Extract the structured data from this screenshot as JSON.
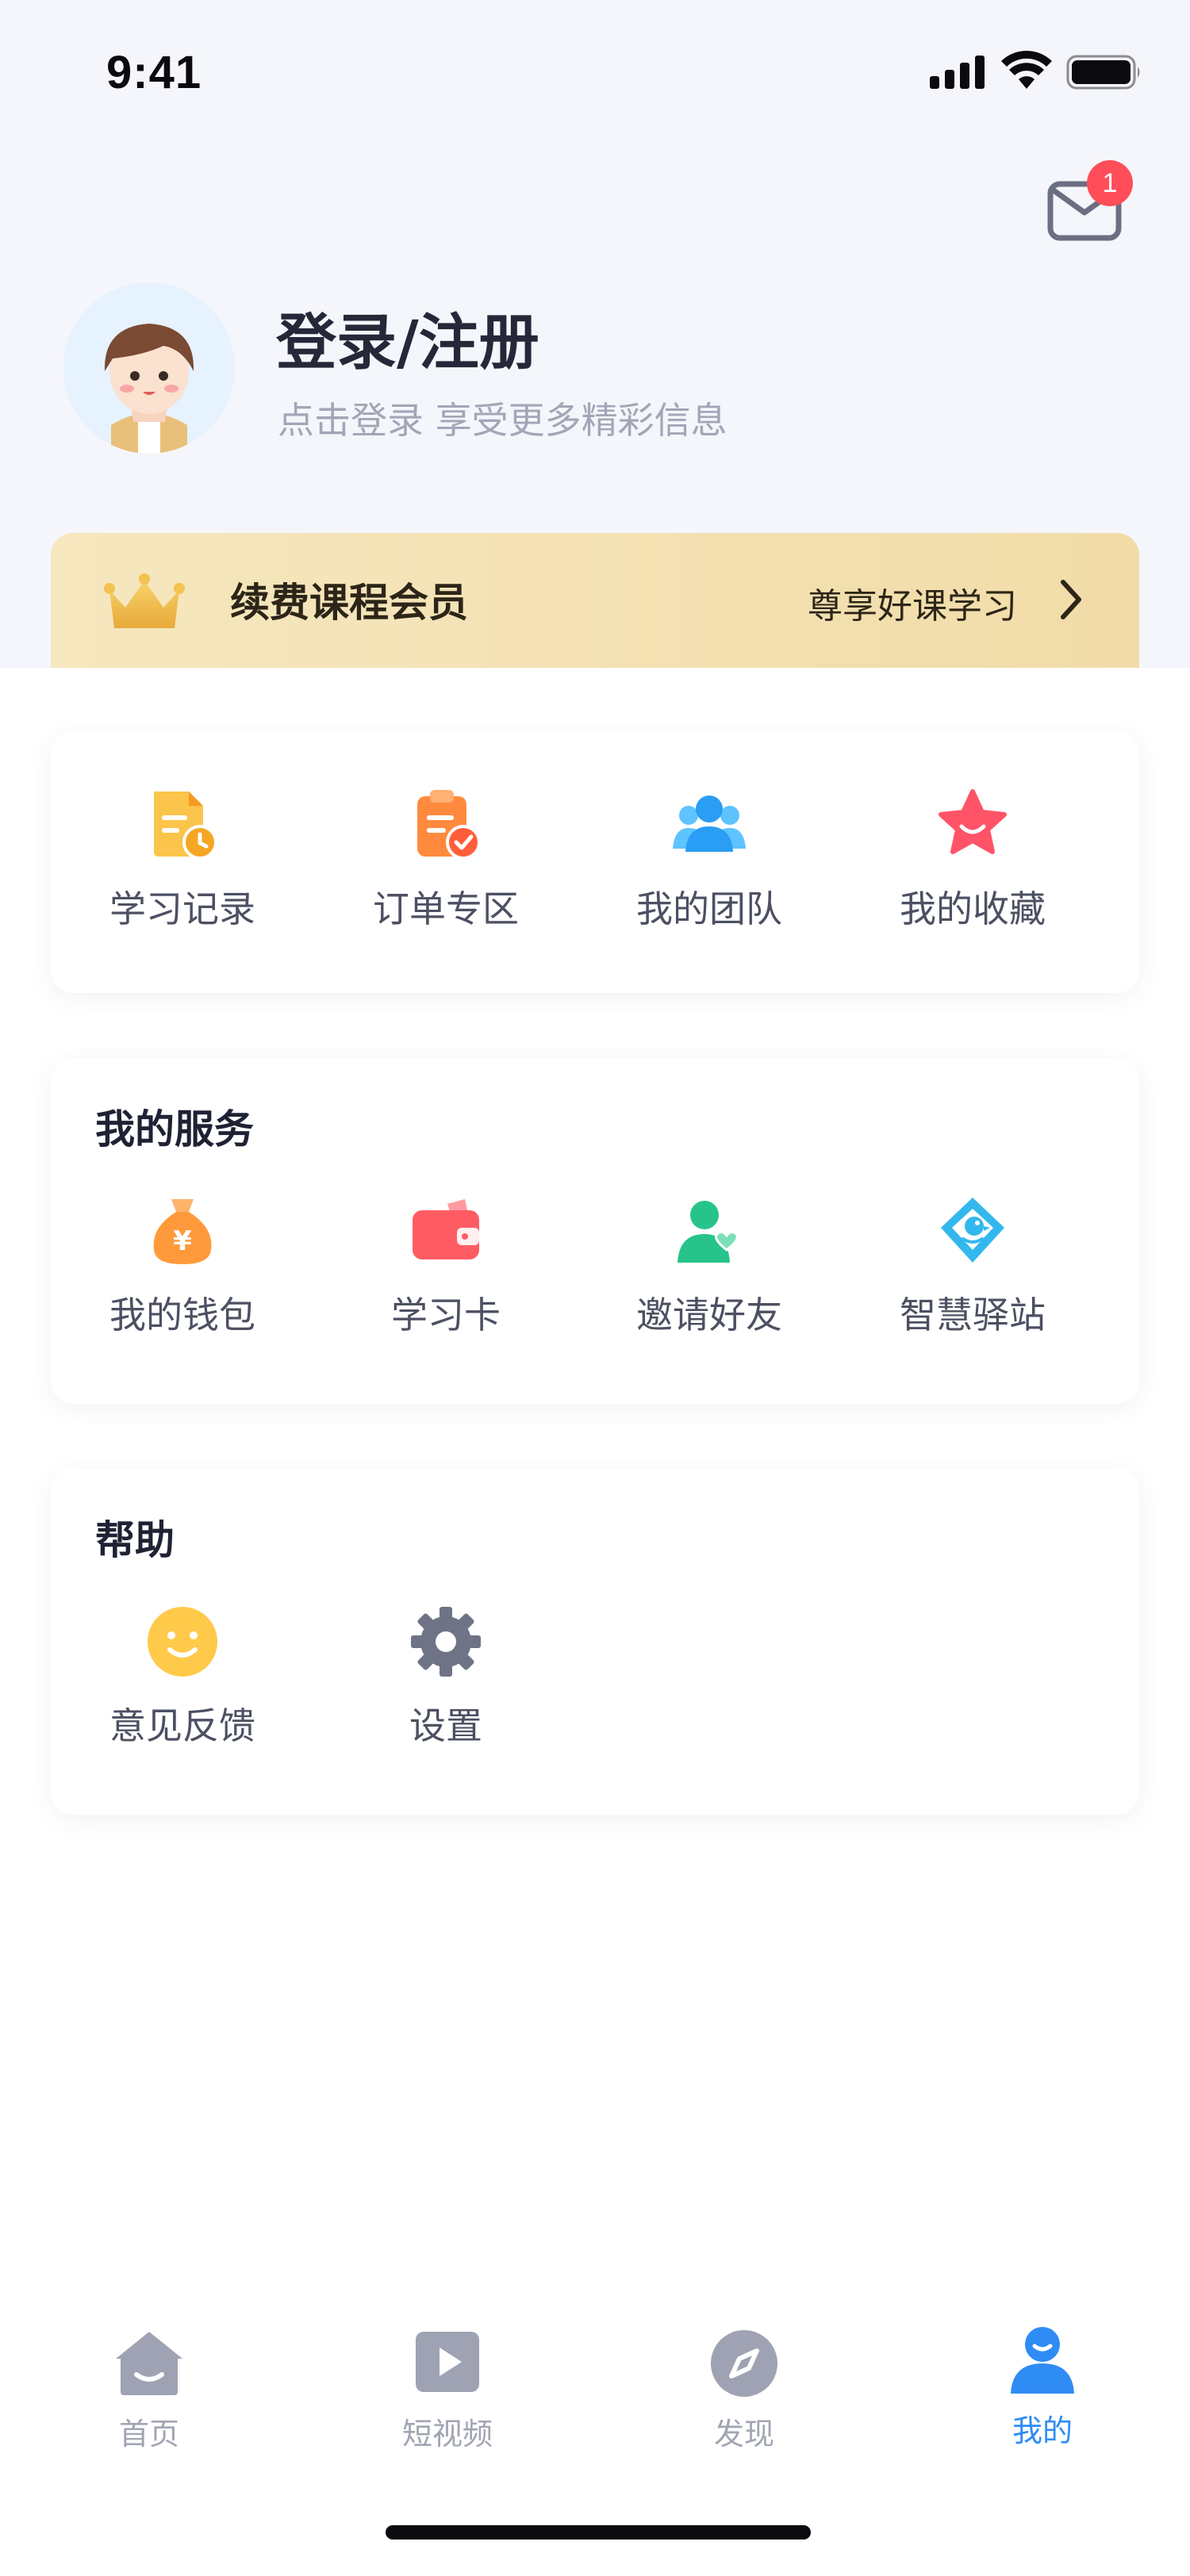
{
  "status_bar": {
    "time": "9:41"
  },
  "header": {
    "mail_badge": "1",
    "login_title": "登录/注册",
    "login_subtitle": "点击登录 享受更多精彩信息",
    "icons": {
      "mail": "mail-icon",
      "avatar": "avatar-icon"
    }
  },
  "vip": {
    "title": "续费课程会员",
    "link": "尊享好课学习",
    "icons": {
      "crown": "crown-icon",
      "arrow": "chevron-right-icon"
    }
  },
  "quick": {
    "items": [
      {
        "label": "学习记录",
        "icon": "study-record-icon"
      },
      {
        "label": "订单专区",
        "icon": "order-icon"
      },
      {
        "label": "我的团队",
        "icon": "team-icon"
      },
      {
        "label": "我的收藏",
        "icon": "favorite-star-icon"
      }
    ]
  },
  "services": {
    "title": "我的服务",
    "items": [
      {
        "label": "我的钱包",
        "icon": "wallet-bag-icon"
      },
      {
        "label": "学习卡",
        "icon": "study-card-icon"
      },
      {
        "label": "邀请好友",
        "icon": "invite-friend-icon"
      },
      {
        "label": "智慧驿站",
        "icon": "bird-icon"
      }
    ]
  },
  "help": {
    "title": "帮助",
    "items": [
      {
        "label": "意见反馈",
        "icon": "smile-feedback-icon"
      },
      {
        "label": "设置",
        "icon": "gear-icon"
      }
    ]
  },
  "tabbar": {
    "active_color": "#2f8cf5",
    "inactive_color": "#a1a5b3",
    "items": [
      {
        "label": "首页",
        "icon": "home-icon",
        "active": false
      },
      {
        "label": "短视频",
        "icon": "play-video-icon",
        "active": false
      },
      {
        "label": "发现",
        "icon": "compass-icon",
        "active": false
      },
      {
        "label": "我的",
        "icon": "profile-icon",
        "active": true
      }
    ]
  }
}
